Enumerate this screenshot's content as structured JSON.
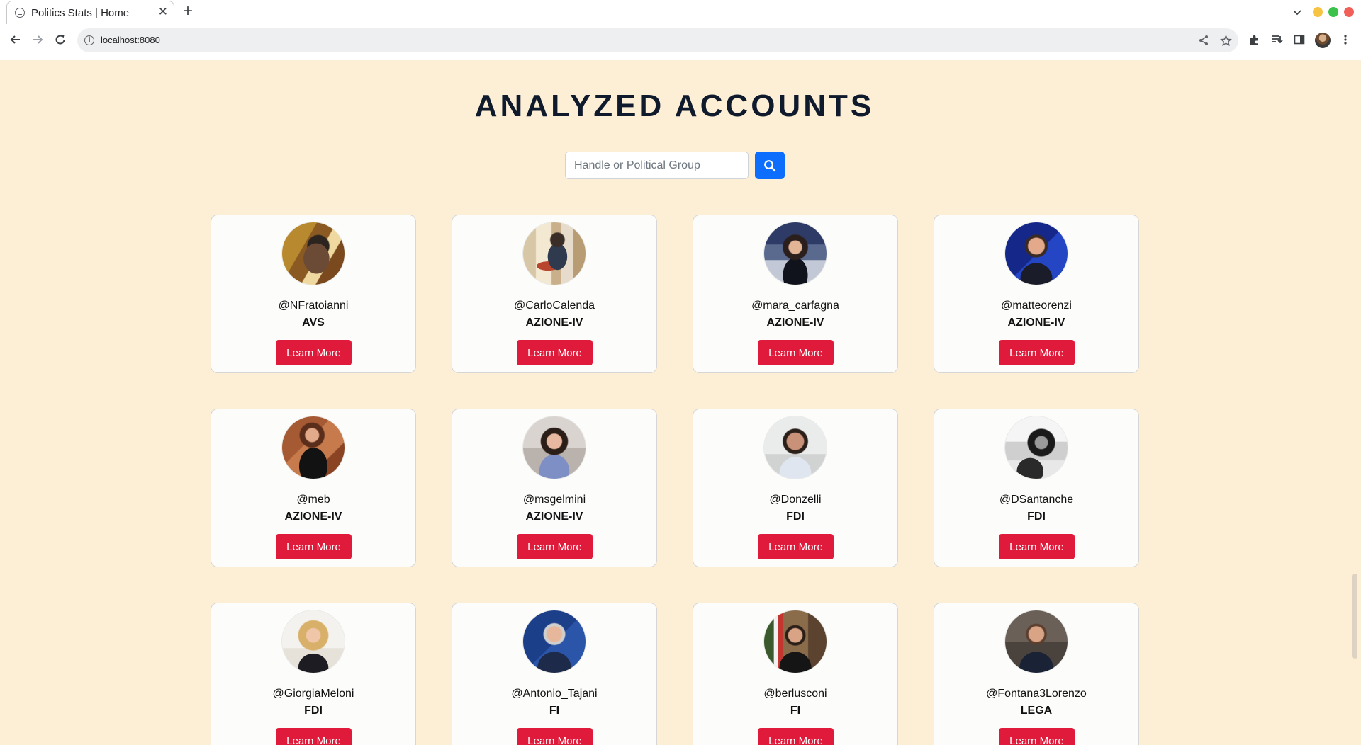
{
  "browser": {
    "tab_title": "Politics Stats | Home",
    "tab_close": "✕",
    "new_tab": "+",
    "url": "localhost:8080",
    "info_glyph": "i",
    "icons": [
      "back-icon",
      "forward-icon",
      "reload-icon",
      "share-icon",
      "star-icon",
      "extensions-icon",
      "reading-list-icon",
      "side-panel-icon",
      "profile-avatar",
      "menu-icon"
    ]
  },
  "page": {
    "title": "ANALYZED ACCOUNTS",
    "search": {
      "placeholder": "Handle or Political Group",
      "button_icon": "search-icon"
    },
    "button_label": "Learn More",
    "accent_colors": {
      "background": "#fdeed6",
      "learn_more": "#e01a3a",
      "search_button": "#0d6efd",
      "title": "#0f1b2d"
    },
    "accounts": [
      {
        "handle": "@NFratoianni",
        "group": "AVS",
        "button": "Learn More"
      },
      {
        "handle": "@CarloCalenda",
        "group": "AZIONE-IV",
        "button": "Learn More"
      },
      {
        "handle": "@mara_carfagna",
        "group": "AZIONE-IV",
        "button": "Learn More"
      },
      {
        "handle": "@matteorenzi",
        "group": "AZIONE-IV",
        "button": "Learn More"
      },
      {
        "handle": "@meb",
        "group": "AZIONE-IV",
        "button": "Learn More"
      },
      {
        "handle": "@msgelmini",
        "group": "AZIONE-IV",
        "button": "Learn More"
      },
      {
        "handle": "@Donzelli",
        "group": "FDI",
        "button": "Learn More"
      },
      {
        "handle": "@DSantanche",
        "group": "FDI",
        "button": "Learn More"
      },
      {
        "handle": "@GiorgiaMeloni",
        "group": "FDI",
        "button": "Learn More"
      },
      {
        "handle": "@Antonio_Tajani",
        "group": "FI",
        "button": "Learn More"
      },
      {
        "handle": "@berlusconi",
        "group": "FI",
        "button": "Learn More"
      },
      {
        "handle": "@Fontana3Lorenzo",
        "group": "LEGA",
        "button": "Learn More"
      }
    ]
  }
}
